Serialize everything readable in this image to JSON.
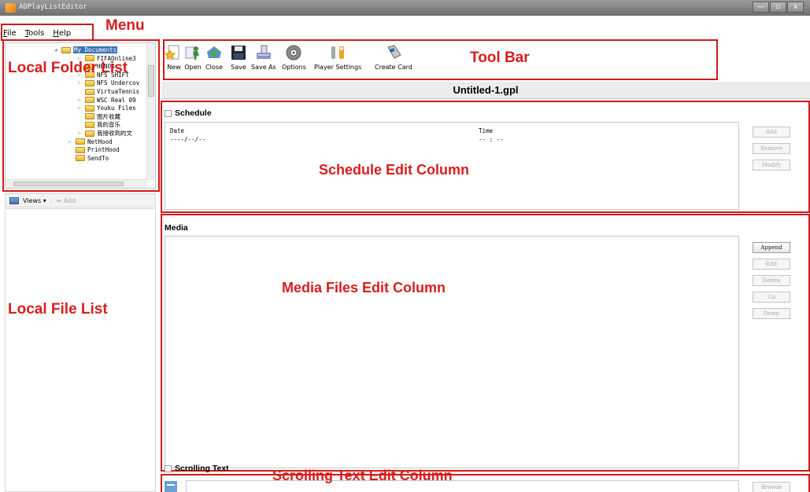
{
  "window": {
    "title": "ADPlayListEditor",
    "buttons": [
      "—",
      "▫",
      "x"
    ]
  },
  "menu": {
    "items": [
      "File",
      "Tools",
      "Help"
    ]
  },
  "annotations": {
    "menu": "Menu",
    "local_folder_list": "Local Folder List",
    "tool_bar": "Tool Bar",
    "schedule_edit": "Schedule Edit Column",
    "media_edit": "Media Files Edit Column",
    "local_file_list": "Local File List",
    "scrolling_edit": "Scrolling Text Edit Column"
  },
  "folder_tree": {
    "items": [
      {
        "label": "My Documents",
        "selected": true,
        "expander": "◢"
      },
      {
        "label": "FIFAOnline3",
        "expander": "▷"
      },
      {
        "label": "HONOR",
        "expander": "▷"
      },
      {
        "label": "NFS SHIFT",
        "expander": "▷"
      },
      {
        "label": "NFS Undercov",
        "expander": "▷"
      },
      {
        "label": "VirtuaTennis",
        "expander": ""
      },
      {
        "label": "WSC Real 09",
        "expander": "▷"
      },
      {
        "label": "Youku Files",
        "expander": "▷"
      },
      {
        "label": "图片收藏",
        "expander": ""
      },
      {
        "label": "我的音乐",
        "expander": ""
      },
      {
        "label": "我接收到的文",
        "expander": "▷"
      },
      {
        "label": "NetHood",
        "expander": "▷"
      },
      {
        "label": "PrintHood",
        "expander": ""
      },
      {
        "label": "SendTo",
        "expander": ""
      }
    ]
  },
  "views_bar": {
    "views_label": "Views ▾",
    "add_label": "⇛ Add"
  },
  "toolbar": {
    "buttons": [
      {
        "label": "New",
        "icon": "new-icon"
      },
      {
        "label": "Open",
        "icon": "open-icon"
      },
      {
        "label": "Close",
        "icon": "close-file-icon"
      },
      {
        "label": "Save",
        "icon": "save-icon"
      },
      {
        "label": "Save As",
        "icon": "save-as-icon"
      },
      {
        "label": "Options",
        "icon": "options-icon"
      },
      {
        "label": "Player Settings",
        "icon": "player-settings-icon"
      },
      {
        "label": "Create Card",
        "icon": "create-card-icon"
      }
    ]
  },
  "file_title": "Untitled-1.gpl",
  "schedule": {
    "label": "Schedule",
    "columns": [
      "Date",
      "Time"
    ],
    "row": {
      "date": "----/--/--",
      "time": "-- : --"
    },
    "buttons": [
      "Add",
      "Remove",
      "Modify"
    ]
  },
  "media": {
    "label": "Media",
    "buttons": [
      "Append",
      "Edit",
      "Delete",
      "Up",
      "Down"
    ]
  },
  "scrolling_text": {
    "label": "Scrolling Text",
    "buttons": [
      "Browse"
    ]
  },
  "colors": {
    "accent_red": "#d81e1e",
    "selection": "#3b6fb6"
  }
}
